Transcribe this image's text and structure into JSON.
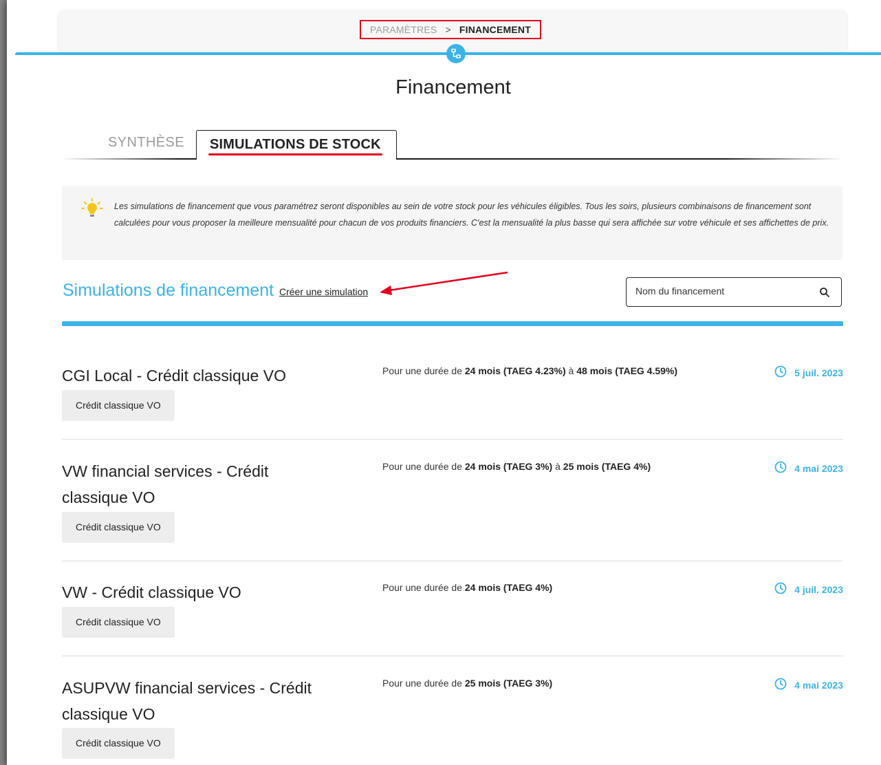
{
  "breadcrumb": {
    "parent": "PARAMÈTRES",
    "separator": ">",
    "current": "FINANCEMENT"
  },
  "page": {
    "title": "Financement"
  },
  "tabs": [
    {
      "label": "SYNTHÈSE",
      "active": false
    },
    {
      "label": "SIMULATIONS DE STOCK",
      "active": true
    }
  ],
  "info": {
    "icon": "lightbulb-icon",
    "text": "Les simulations de financement que vous paramétrez seront disponibles au sein de votre stock pour les véhicules éligibles. Tous les soirs, plusieurs combinaisons de financement sont calculées pour vous proposer la meilleure mensualité pour chacun de vos produits financiers. C'est la mensualité la plus basse qui sera affichée sur votre véhicule et ses affichettes de prix."
  },
  "section": {
    "title": "Simulations de financement",
    "create_link": "Créer une simulation"
  },
  "search": {
    "placeholder": "Nom du financement",
    "value": ""
  },
  "simulations": [
    {
      "title": "CGI Local - Crédit classique VO",
      "tag": "Crédit classique VO",
      "desc_prefix": "Pour une durée de ",
      "desc_part1": "24 mois (TAEG 4.23%)",
      "desc_mid": " à ",
      "desc_part2": "48 mois (TAEG 4.59%)",
      "date": "5 juil. 2023"
    },
    {
      "title": "VW financial services - Crédit classique VO",
      "tag": "Crédit classique VO",
      "desc_prefix": "Pour une durée de ",
      "desc_part1": "24 mois (TAEG 3%)",
      "desc_mid": " à ",
      "desc_part2": "25 mois (TAEG 4%)",
      "date": "4 mai 2023"
    },
    {
      "title": "VW - Crédit classique VO",
      "tag": "Crédit classique VO",
      "desc_prefix": "Pour une durée de ",
      "desc_part1": "24 mois (TAEG 4%)",
      "desc_mid": "",
      "desc_part2": "",
      "date": "4 juil. 2023"
    },
    {
      "title": "ASUPVW financial services - Crédit classique VO",
      "tag": "Crédit classique VO",
      "desc_prefix": "Pour une durée de ",
      "desc_part1": "25 mois (TAEG 3%)",
      "desc_mid": "",
      "desc_part2": "",
      "date": "4 mai 2023"
    }
  ],
  "colors": {
    "accent": "#3bb3e8",
    "annotation": "#e3001b",
    "muted": "#9b9b9b"
  }
}
